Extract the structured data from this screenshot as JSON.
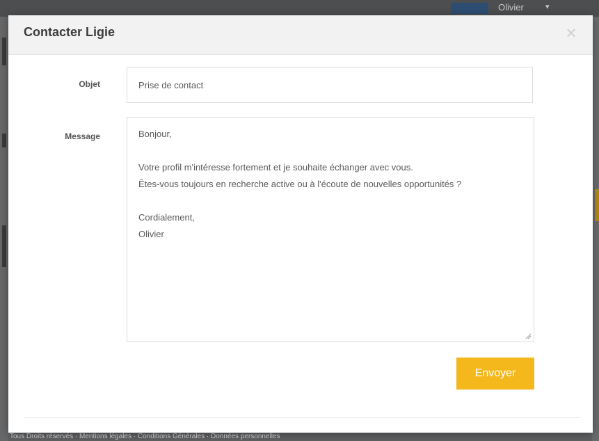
{
  "background": {
    "user_name": "Olivier",
    "footer_text": "Tous Droits réservés · Mentions légales · Conditions Générales · Données personnelles"
  },
  "modal": {
    "title": "Contacter Ligie",
    "close_icon": "close-icon",
    "fields": {
      "subject_label": "Objet",
      "subject_value": "Prise de contact",
      "message_label": "Message",
      "message_value": "Bonjour,\n\nVotre profil m'intéresse fortement et je souhaite échanger avec vous.\nÊtes-vous toujours en recherche active ou à l'écoute de nouvelles opportunités ?\n\nCordialement,\nOlivier"
    },
    "send_label": "Envoyer"
  },
  "colors": {
    "accent": "#f4b81c",
    "overlay": "#5f6062",
    "header_bg": "#f2f2f2"
  }
}
